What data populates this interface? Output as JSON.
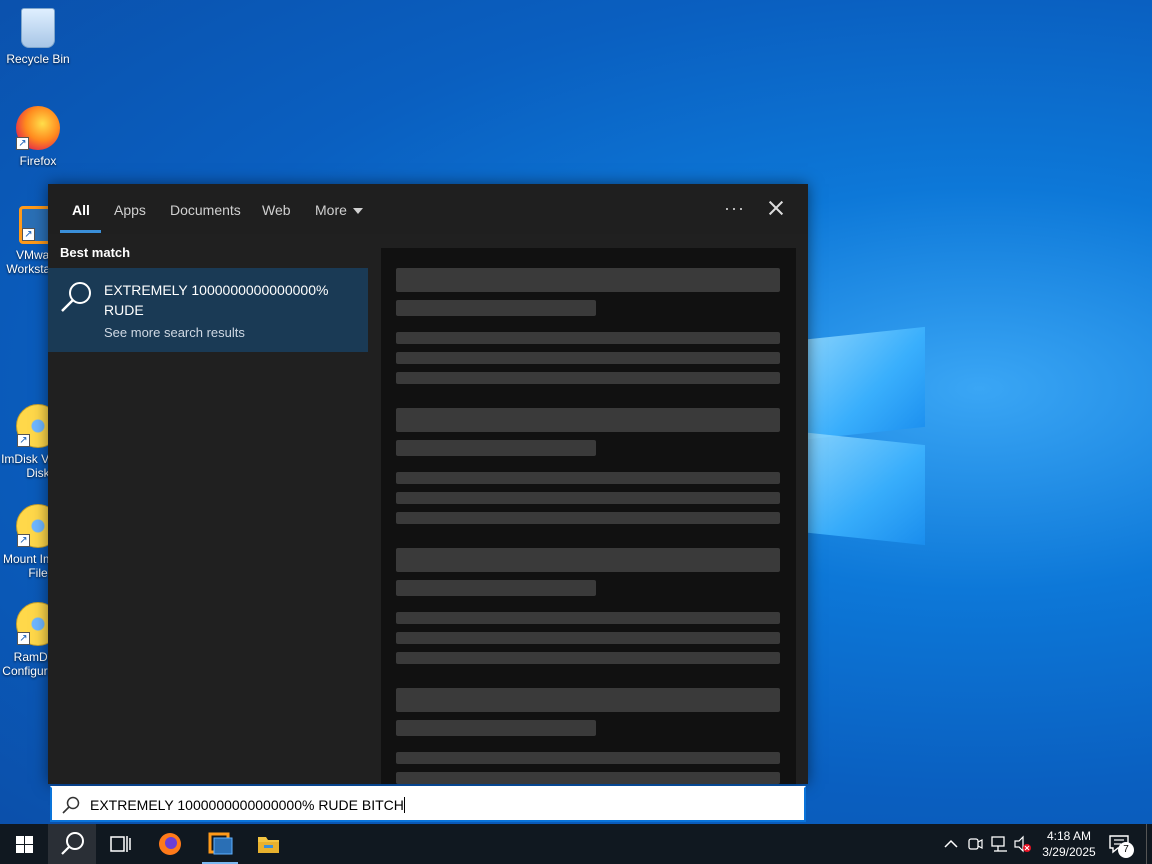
{
  "desktop": {
    "icons": [
      {
        "label": "Recycle Bin"
      },
      {
        "label": "Firefox"
      },
      {
        "label": "VMware Workstation"
      },
      {
        "label": "ImDisk Virtual Disk"
      },
      {
        "label": "Mount Image File"
      },
      {
        "label": "RamDisk Configuration"
      }
    ]
  },
  "search_flyout": {
    "tabs": [
      {
        "label": "All",
        "active": true
      },
      {
        "label": "Apps"
      },
      {
        "label": "Documents"
      },
      {
        "label": "Web"
      },
      {
        "label": "More"
      }
    ],
    "more_options_label": "···",
    "best_match_heading": "Best match",
    "best_match": {
      "title": "EXTREMELY 1000000000000000% RUDE",
      "subtitle": "See more search results"
    }
  },
  "search_box": {
    "value": "EXTREMELY 1000000000000000% RUDE BITCH"
  },
  "taskbar": {
    "clock_time": "4:18 AM",
    "clock_date": "3/29/2025",
    "notification_count": "7"
  },
  "colors": {
    "accent": "#0a74da",
    "flyout_bg": "#202020",
    "selected_item_bg": "#1a3a55",
    "taskbar_bg": "#101820"
  }
}
